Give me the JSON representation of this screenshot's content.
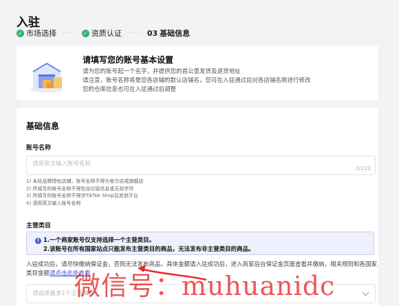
{
  "header": {
    "title": "入驻",
    "steps": [
      {
        "label": "市场选择",
        "done": true
      },
      {
        "label": "资质认证",
        "done": true
      },
      {
        "number": "03",
        "label": "基础信息",
        "done": false
      }
    ]
  },
  "intro": {
    "title": "请填写您的账号基本设置",
    "lines": [
      "请为您的账号起一个名字，并提供您的首公里发货及退货地址",
      "请注意，账号名称将是您各店铺的默认店铺名，您可在入驻通过后对各店铺名称进行修改",
      "您的仓库信息也可在入驻通过后调整"
    ]
  },
  "form": {
    "section_title": "基础信息",
    "account_name": {
      "label": "账号名称",
      "placeholder": "请用英文输入账号名称",
      "counter": "0/120",
      "rules": [
        "1) 未经品牌授权店铺，账号名称不得为官方店或旗舰店",
        "2) 所填写的账号名称不得包含垃圾信息或无效字符",
        "3) 所填写的账号名称不得涉TikTok Shop及其他平台",
        "4) 请用英文输入账号名称"
      ]
    },
    "main_category": {
      "label": "主营类目",
      "notice": [
        "1.一个商家账号仅支持选择一个主营类目。",
        "2.该账号在所有国家站点只能发布主营类目的商品，无法发布非主营类目的商品。"
      ],
      "desc_before": "入驻成功后，请尽快缴纳保证金，否则无法发布商品，具体金额请入驻成功后，进入商家后台保证金页面查看并缴纳，相关规则和各国家类目金额",
      "desc_link": "请点击此处查看",
      "placeholder": "请选择最多1个主营类目"
    }
  },
  "watermark": "微信号：muhuanidc",
  "colors": {
    "accent": "#3957d6",
    "success": "#2fb36d",
    "notice_bg": "#eef0fb",
    "watermark": "#e62828"
  }
}
